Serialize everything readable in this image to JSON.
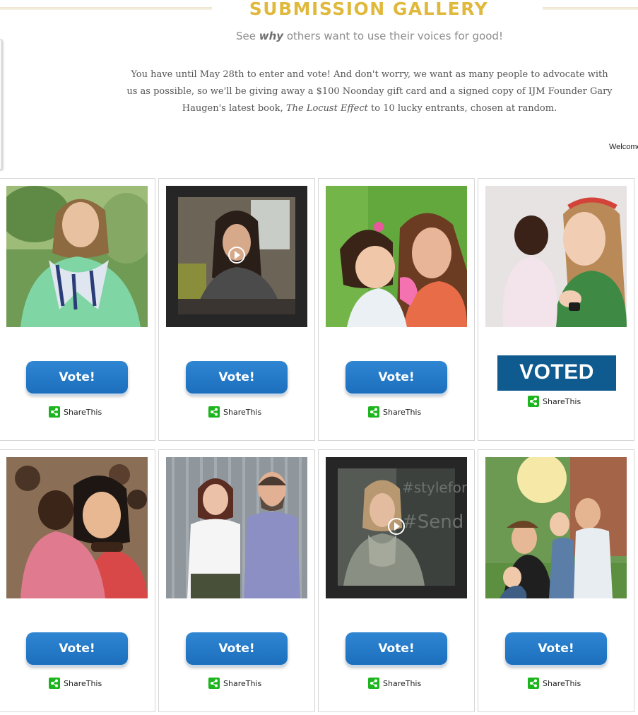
{
  "header": {
    "title": "SUBMISSION GALLERY",
    "subtitle_pre": "See ",
    "subtitle_em": "why",
    "subtitle_post": " others want to use their voices for good!",
    "intro_pre": "You have until May 28th to enter and vote! And don't worry, we want as many people to advocate with us as possible, so we'll be giving away a $100 Noonday gift card and a signed copy of IJM Founder Gary Haugen's latest book, ",
    "intro_book": "The Locust Effect",
    "intro_post": " to 10 lucky entrants, chosen at random.",
    "welcome": "Welcome"
  },
  "colors": {
    "title_gold": "#e0b93c",
    "vote_blue": "#1c6fbd",
    "voted_navy": "#0f5a8e",
    "share_green": "#1db51d"
  },
  "entries": [
    {
      "vote_label": "Vote!",
      "share_label": "ShareThis",
      "media": "photo",
      "voted": false
    },
    {
      "vote_label": "Vote!",
      "share_label": "ShareThis",
      "media": "video",
      "voted": false
    },
    {
      "vote_label": "Vote!",
      "share_label": "ShareThis",
      "media": "photo",
      "voted": false
    },
    {
      "vote_label": "VOTED",
      "share_label": "ShareThis",
      "media": "photo",
      "voted": true
    },
    {
      "vote_label": "Vote!",
      "share_label": "ShareThis",
      "media": "photo",
      "voted": false
    },
    {
      "vote_label": "Vote!",
      "share_label": "ShareThis",
      "media": "photo",
      "voted": false
    },
    {
      "vote_label": "Vote!",
      "share_label": "ShareThis",
      "media": "video",
      "voted": false
    },
    {
      "vote_label": "Vote!",
      "share_label": "ShareThis",
      "media": "photo",
      "voted": false
    }
  ]
}
